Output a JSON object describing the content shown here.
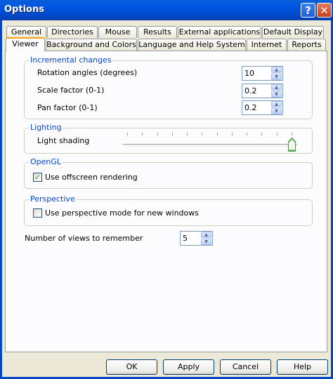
{
  "window": {
    "title": "Options",
    "help_glyph": "?",
    "close_glyph": "✕"
  },
  "tabs": {
    "row1": [
      "General",
      "Directories",
      "Mouse",
      "Results",
      "External applications",
      "Default Display"
    ],
    "row2": [
      "Viewer",
      "Background and Colors",
      "Language and Help System",
      "Internet",
      "Reports"
    ],
    "active": "Viewer"
  },
  "incremental": {
    "legend": "Incremental changes",
    "rotation_label": "Rotation angles (degrees)",
    "rotation_value": "10",
    "scale_label": "Scale factor (0-1)",
    "scale_value": "0.2",
    "pan_label": "Pan factor (0-1)",
    "pan_value": "0.2"
  },
  "lighting": {
    "legend": "Lighting",
    "shading_label": "Light shading",
    "shading_level": 1.0,
    "tick_count": 12
  },
  "opengl": {
    "legend": "OpenGL",
    "offscreen_label": "Use offscreen rendering",
    "offscreen_checked": true
  },
  "perspective": {
    "legend": "Perspective",
    "perspective_label": "Use perspective mode for new windows",
    "perspective_checked": false
  },
  "views": {
    "label": "Number of views to remember",
    "value": "5"
  },
  "buttons": {
    "ok": "OK",
    "apply": "Apply",
    "cancel": "Cancel",
    "help": "Help"
  },
  "colors": {
    "title_bar": "#0054e3",
    "legend_text": "#0046d5",
    "tab_highlight": "#f5a10c",
    "check_mark": "#21a121"
  }
}
